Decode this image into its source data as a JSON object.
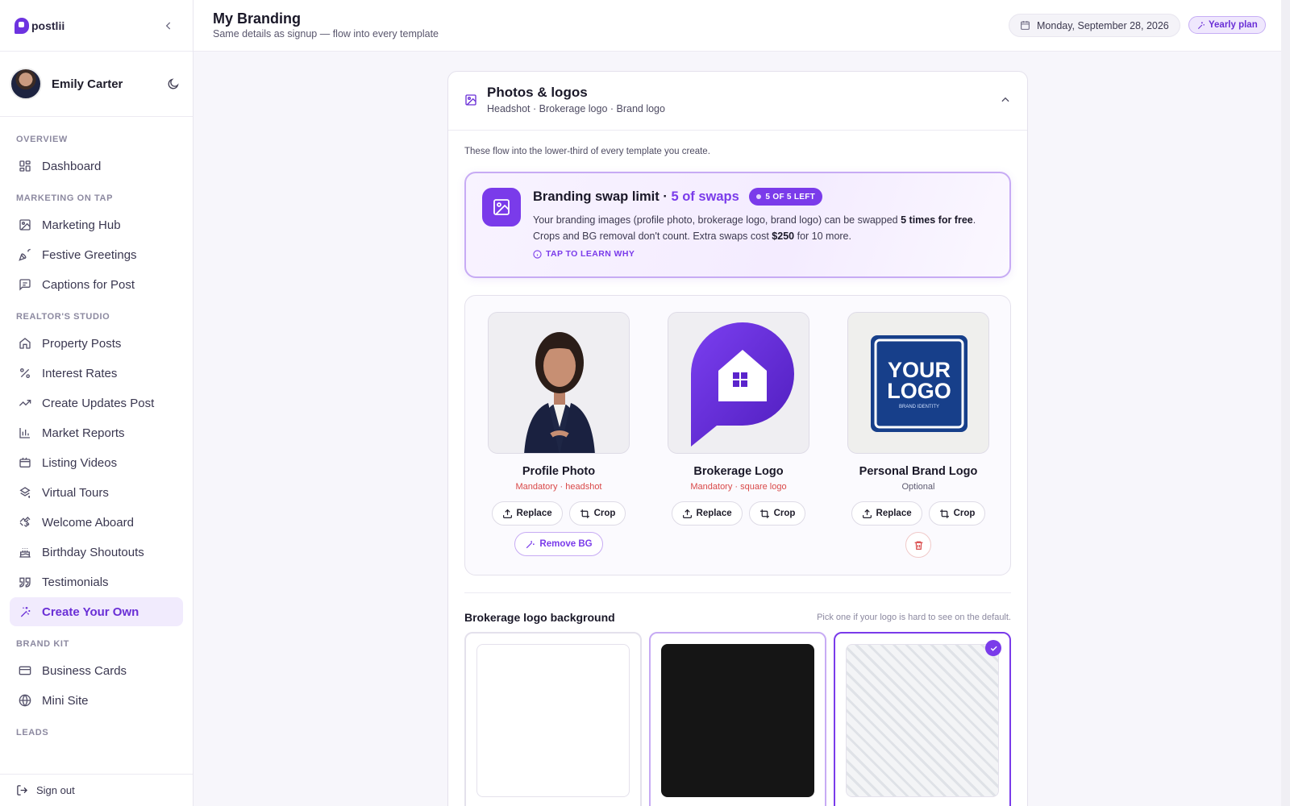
{
  "app": {
    "logo_text": "postlii"
  },
  "user": {
    "name": "Emily Carter"
  },
  "nav": {
    "sections": [
      {
        "title": "OVERVIEW",
        "items": [
          {
            "label": "Dashboard",
            "icon": "dashboard-icon"
          }
        ]
      },
      {
        "title": "MARKETING ON TAP",
        "items": [
          {
            "label": "Marketing Hub",
            "icon": "image-icon"
          },
          {
            "label": "Festive Greetings",
            "icon": "party-popper-icon"
          },
          {
            "label": "Captions for Post",
            "icon": "message-square-icon"
          }
        ]
      },
      {
        "title": "REALTOR'S STUDIO",
        "items": [
          {
            "label": "Property Posts",
            "icon": "home-icon"
          },
          {
            "label": "Interest Rates",
            "icon": "percent-icon"
          },
          {
            "label": "Create Updates Post",
            "icon": "trending-up-icon"
          },
          {
            "label": "Market Reports",
            "icon": "bar-chart-icon"
          },
          {
            "label": "Listing Videos",
            "icon": "video-icon"
          },
          {
            "label": "Virtual Tours",
            "icon": "rotate-3d-icon"
          },
          {
            "label": "Welcome Aboard",
            "icon": "handshake-icon"
          },
          {
            "label": "Birthday Shoutouts",
            "icon": "cake-icon"
          },
          {
            "label": "Testimonials",
            "icon": "quote-icon"
          },
          {
            "label": "Create Your Own",
            "icon": "sparkles-icon",
            "active": true
          }
        ]
      },
      {
        "title": "BRAND KIT",
        "items": [
          {
            "label": "Business Cards",
            "icon": "credit-card-icon"
          },
          {
            "label": "Mini Site",
            "icon": "globe-icon"
          }
        ]
      },
      {
        "title": "LEADS",
        "items": []
      }
    ],
    "sign_out": "Sign out"
  },
  "header": {
    "title": "My Branding",
    "subtitle": "Same details as signup — flow into every template",
    "date": "Monday, September 28, 2026",
    "plan": "Yearly plan"
  },
  "card": {
    "title": "Photos & logos",
    "subtitle": "Headshot · Brokerage logo · Brand logo",
    "intro": "These flow into the lower-third of every template you create.",
    "limit": {
      "title": "Branding swap limit ·",
      "title_accent": "5 of swaps",
      "badge": "5 OF 5 LEFT",
      "body_1": "Your branding images (profile photo, brokerage logo, brand logo) can be swapped",
      "body_bold_1": "5 times for free",
      "body_2": ". Crops and BG removal don't count. Extra swaps cost",
      "body_bold_2": "$250",
      "body_3": "for 10 more.",
      "learn": "TAP TO LEARN WHY"
    },
    "images": [
      {
        "label": "Profile Photo",
        "requirement": "Mandatory · headshot",
        "replace": "Replace",
        "crop": "Crop",
        "remove_bg": "Remove BG"
      },
      {
        "label": "Brokerage Logo",
        "requirement": "Mandatory · square logo",
        "replace": "Replace",
        "crop": "Crop"
      },
      {
        "label": "Personal Brand Logo",
        "requirement": "Optional",
        "replace": "Replace",
        "crop": "Crop",
        "logo_line1": "YOUR",
        "logo_line2": "LOGO",
        "logo_tag": "BRAND IDENTITY"
      }
    ],
    "background": {
      "title": "Brokerage logo background",
      "hint": "Pick one if your logo is hard to see on the default.",
      "options": [
        {
          "name": "white",
          "color": "#ffffff"
        },
        {
          "name": "black",
          "color": "#151515"
        },
        {
          "name": "transparent",
          "color": "#f3f4f6",
          "selected": true
        }
      ]
    }
  },
  "colors": {
    "accent": "#7a3bea",
    "danger": "#d94848"
  }
}
